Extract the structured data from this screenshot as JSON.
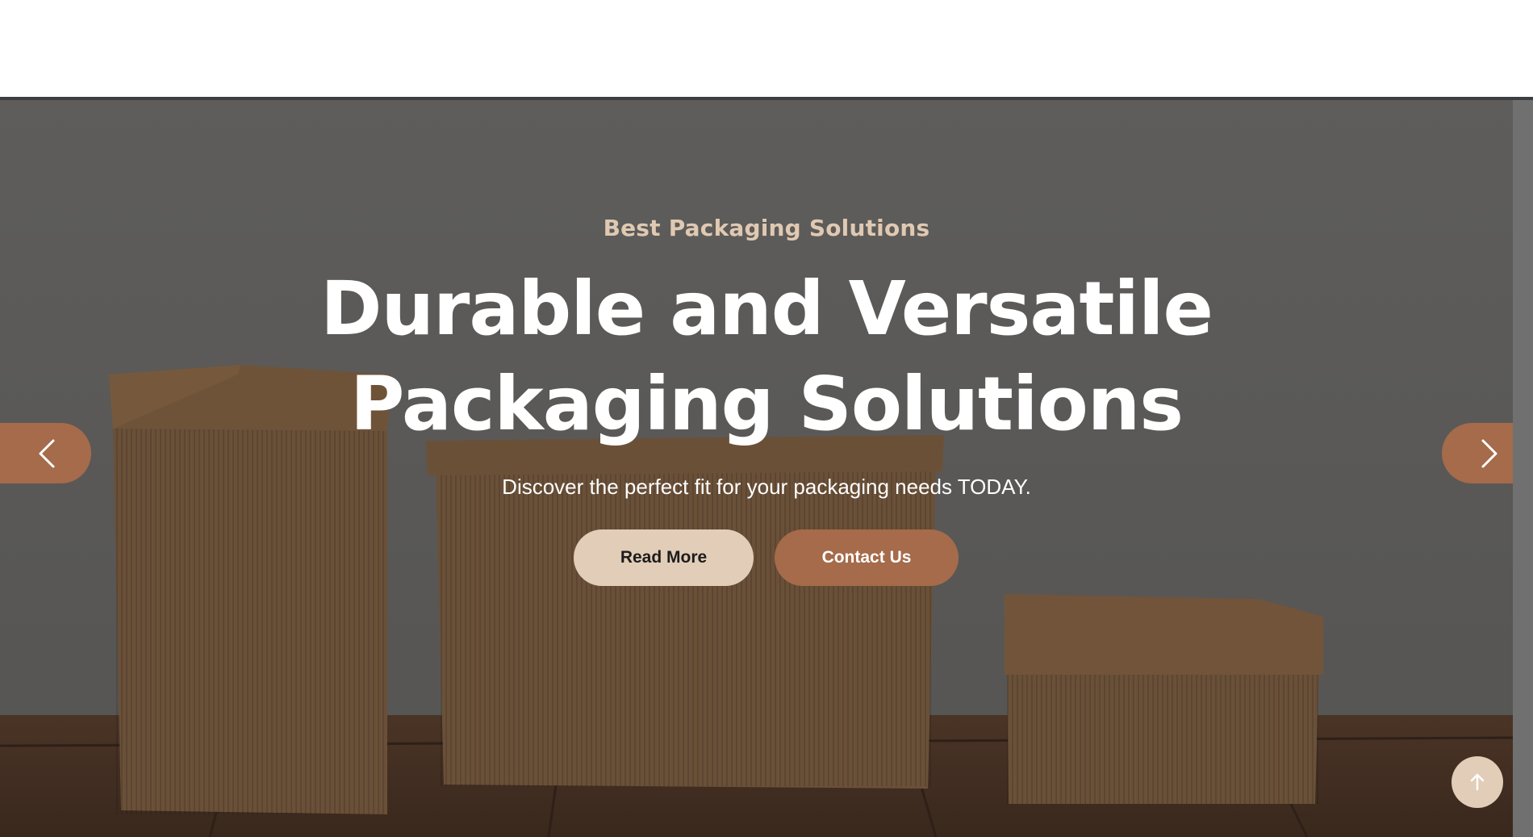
{
  "hero": {
    "subtitle": "Best Packaging Solutions",
    "title_line1": "Durable and Versatile",
    "title_line2": "Packaging Solutions",
    "lead": "Discover the perfect fit for your packaging needs TODAY.",
    "read_more_label": "Read More",
    "contact_label": "Contact Us"
  },
  "carousel": {
    "prev_icon": "chevron-left-icon",
    "next_icon": "chevron-right-icon"
  },
  "back_to_top": {
    "icon": "arrow-up-icon"
  },
  "colors": {
    "accent": "#a56b4a",
    "light_accent": "#e2cdb8",
    "subtitle": "#e0c9b2"
  }
}
